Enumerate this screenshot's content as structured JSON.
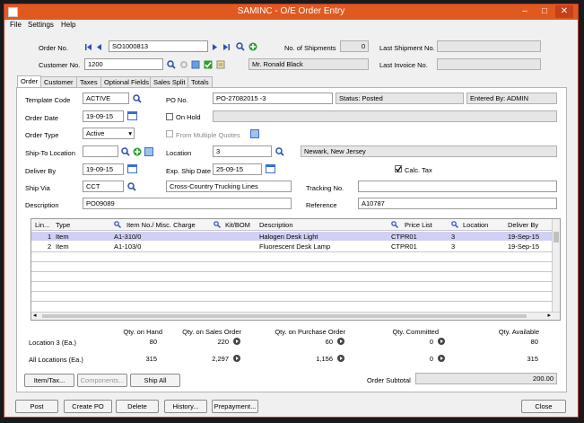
{
  "window": {
    "title": "SAMINC - O/E Order Entry",
    "min": "–",
    "max": "□",
    "close": "✕"
  },
  "menu": [
    "File",
    "Settings",
    "Help"
  ],
  "header": {
    "order_no_label": "Order No.",
    "order_no": "SO1000813",
    "shipments_label": "No. of Shipments",
    "shipments": "0",
    "last_shipment_label": "Last Shipment No.",
    "last_shipment": "",
    "customer_no_label": "Customer No.",
    "customer_no": "1200",
    "customer_name": "Mr. Ronald Black",
    "last_invoice_label": "Last Invoice No.",
    "last_invoice": ""
  },
  "tabs": [
    "Order",
    "Customer",
    "Taxes",
    "Optional Fields",
    "Sales Split",
    "Totals"
  ],
  "form": {
    "template_code_label": "Template Code",
    "template_code": "ACTIVE",
    "po_no_label": "PO No.",
    "po_no": "PO-27082015 -3",
    "status": "Status: Posted",
    "entered_by": "Entered By: ADMIN",
    "order_date_label": "Order Date",
    "order_date": "19-09-15",
    "on_hold_label": "On Hold",
    "order_type_label": "Order Type",
    "order_type": "Active",
    "from_quotes_label": "From Multiple Quotes",
    "ship_to_label": "Ship-To Location",
    "ship_to": "",
    "location_label": "Location",
    "location": "3",
    "location_desc": "Newark, New Jersey",
    "deliver_by_label": "Deliver By",
    "deliver_by": "19-09-15",
    "exp_ship_label": "Exp. Ship Date",
    "exp_ship": "25-09-15",
    "calc_tax_label": "Calc. Tax",
    "ship_via_label": "Ship Via",
    "ship_via": "CCT",
    "ship_via_desc": "Cross-Country Trucking Lines",
    "tracking_label": "Tracking No.",
    "tracking": "",
    "description_label": "Description",
    "description": "PO09089",
    "reference_label": "Reference",
    "reference": "A10787"
  },
  "grid": {
    "columns": [
      "Lin...",
      "Type",
      "Item No./ Misc. Charge",
      "Kit/BOM",
      "Description",
      "Price List",
      "Location",
      "Deliver By"
    ],
    "rows": [
      [
        "1",
        "Item",
        "A1-310/0",
        "",
        "Halogen Desk Light",
        "CTPR01",
        "3",
        "19-Sep-15"
      ],
      [
        "2",
        "Item",
        "A1-103/0",
        "",
        "Fluorescent Desk Lamp",
        "CTPR01",
        "3",
        "19-Sep-15"
      ]
    ]
  },
  "qty": {
    "headers": [
      "Qty. on Hand",
      "Qty. on Sales Order",
      "Qty. on Purchase Order",
      "Qty. Committed",
      "Qty. Available"
    ],
    "location_label": "Location  3 (Ea.)",
    "location_values": [
      "80",
      "220",
      "60",
      "0",
      "80"
    ],
    "all_label": "All Locations (Ea.)",
    "all_values": [
      "315",
      "2,297",
      "1,156",
      "0",
      "315"
    ]
  },
  "actions": {
    "item_tax": "Item/Tax...",
    "components": "Components...",
    "ship_all": "Ship All",
    "subtotal_label": "Order Subtotal",
    "subtotal": "200.00"
  },
  "footer": {
    "post": "Post",
    "create_po": "Create PO",
    "delete": "Delete",
    "history": "History...",
    "prepayment": "Prepayment...",
    "close": "Close"
  },
  "colors": {
    "title_bar": "#e05a1f",
    "selected_row": "#cfd0f3",
    "accent": "#3a6fd0"
  }
}
